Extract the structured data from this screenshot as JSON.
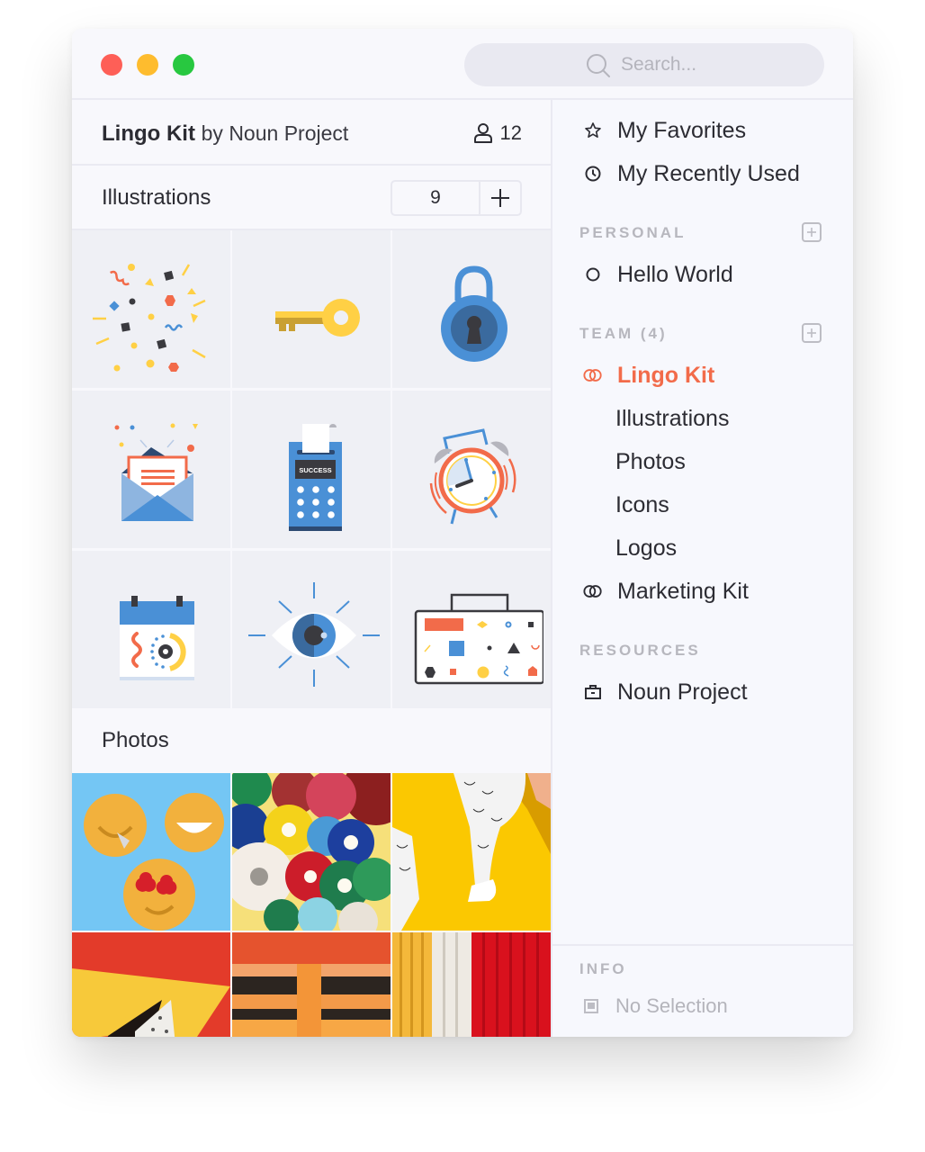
{
  "window": {
    "traffic_lights": [
      "close",
      "minimize",
      "maximize"
    ],
    "search": {
      "placeholder": "Search...",
      "value": "",
      "icon": "search-icon"
    }
  },
  "main": {
    "kit": {
      "name": "Lingo Kit",
      "by": "by Noun Project",
      "member_count": "12",
      "member_icon": "user-icon"
    },
    "illustrations": {
      "title": "Illustrations",
      "count": "9",
      "add_icon": "plus-icon",
      "items": [
        {
          "name": "Confetti"
        },
        {
          "name": "Key"
        },
        {
          "name": "Padlock"
        },
        {
          "name": "Envelope"
        },
        {
          "name": "Payment Terminal",
          "label": "SUCCESS"
        },
        {
          "name": "Alarm Clock"
        },
        {
          "name": "Calendar"
        },
        {
          "name": "Eye"
        },
        {
          "name": "Toolbox"
        }
      ]
    },
    "photos": {
      "title": "Photos",
      "items": [
        {
          "name": "Emoji Cookies",
          "colors": [
            "#74c6f4",
            "#f2b13d"
          ]
        },
        {
          "name": "Vinyl Records",
          "colors": [
            "#f6e07a",
            "#8c1f1f"
          ]
        },
        {
          "name": "Dancer on Yellow",
          "colors": [
            "#fbc801",
            "#ffffff"
          ]
        },
        {
          "name": "Paper Shapes",
          "colors": [
            "#e33b2a",
            "#f7c93a"
          ]
        },
        {
          "name": "Orange Building",
          "colors": [
            "#ef6a3c",
            "#f6a43f"
          ]
        },
        {
          "name": "Curtains",
          "colors": [
            "#f4b83a",
            "#d9111d"
          ]
        }
      ]
    }
  },
  "sidebar": {
    "top_items": [
      {
        "label": "My Favorites",
        "icon": "star-icon"
      },
      {
        "label": "My Recently Used",
        "icon": "clock-icon"
      }
    ],
    "personal": {
      "label": "PERSONAL",
      "items": [
        {
          "label": "Hello World",
          "icon": "circle-icon"
        }
      ]
    },
    "team": {
      "label": "TEAM (4)",
      "items": [
        {
          "label": "Lingo Kit",
          "icon": "kit-icon",
          "active": true
        },
        {
          "label": "Illustrations"
        },
        {
          "label": "Photos"
        },
        {
          "label": "Icons"
        },
        {
          "label": "Logos"
        },
        {
          "label": "Marketing Kit",
          "icon": "kit-icon"
        }
      ]
    },
    "resources": {
      "label": "RESOURCES",
      "items": [
        {
          "label": "Noun Project",
          "icon": "briefcase-icon"
        }
      ]
    },
    "info": {
      "label": "INFO",
      "value": "No Selection",
      "icon": "selection-icon"
    }
  },
  "colors": {
    "accent": "#f26b4a",
    "blue": "#4a90d6",
    "yellow": "#ffd045",
    "dark": "#3a3a3f"
  }
}
